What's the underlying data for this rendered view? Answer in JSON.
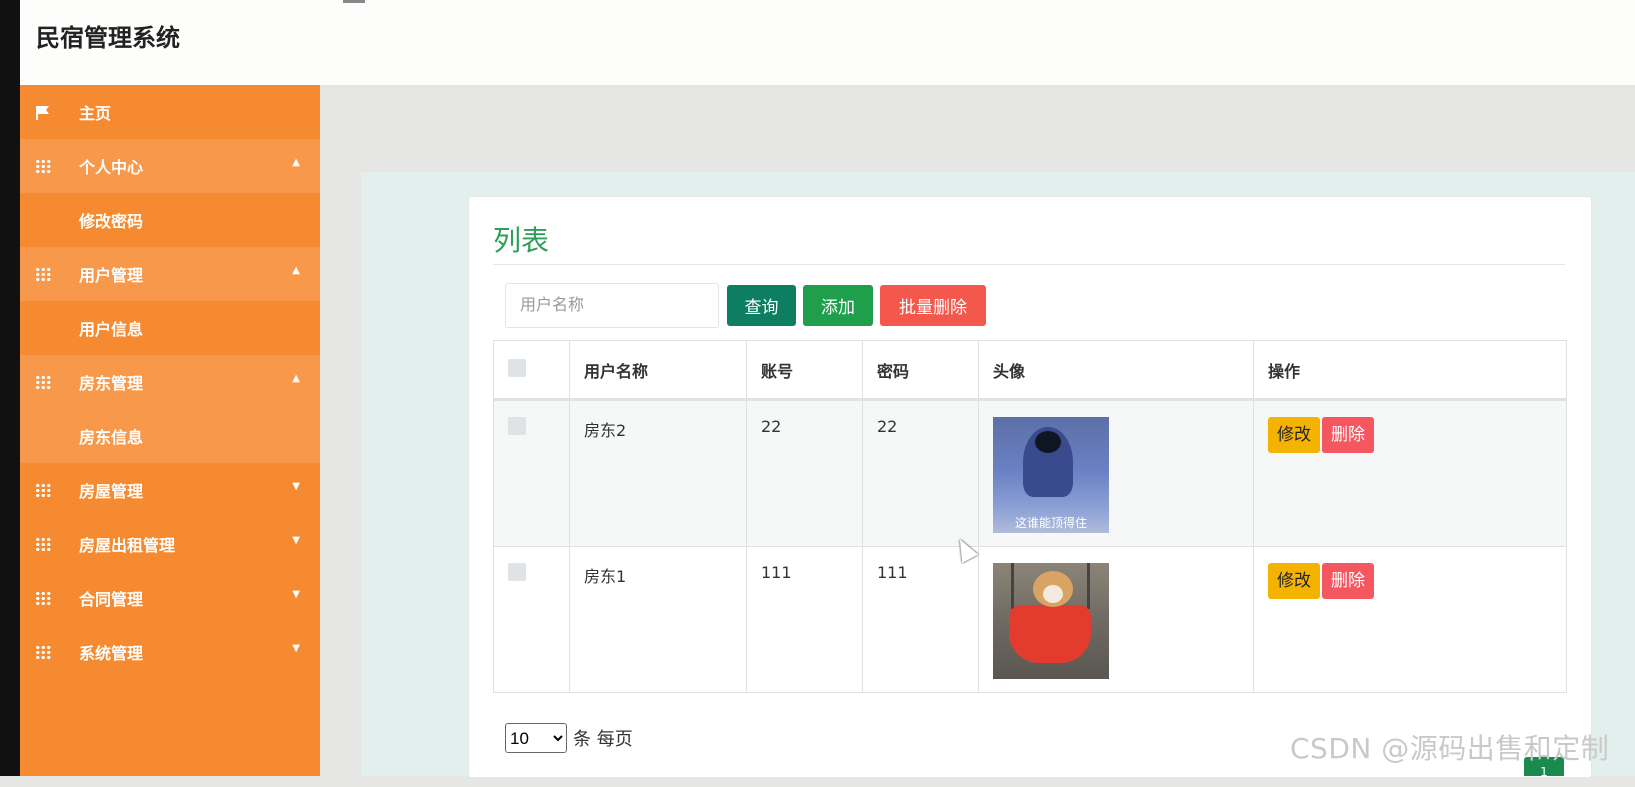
{
  "app": {
    "title": "民宿管理系统"
  },
  "sidebar": {
    "items": [
      {
        "label": "主页",
        "icon": "flag-icon"
      },
      {
        "label": "个人中心",
        "icon": "grid-icon",
        "expanded": true,
        "children": [
          "修改密码"
        ]
      },
      {
        "label": "用户管理",
        "icon": "grid-icon",
        "expanded": true,
        "children": [
          "用户信息"
        ]
      },
      {
        "label": "房东管理",
        "icon": "grid-icon",
        "expanded": true,
        "children": [
          "房东信息"
        ]
      },
      {
        "label": "房屋管理",
        "icon": "grid-icon",
        "expanded": false
      },
      {
        "label": "房屋出租管理",
        "icon": "grid-icon",
        "expanded": false
      },
      {
        "label": "合同管理",
        "icon": "grid-icon",
        "expanded": false
      },
      {
        "label": "系统管理",
        "icon": "grid-icon",
        "expanded": false
      }
    ]
  },
  "main": {
    "title": "列表",
    "search": {
      "placeholder": "用户名称",
      "value": ""
    },
    "buttons": {
      "query": "查询",
      "add": "添加",
      "batch_delete": "批量删除"
    },
    "table": {
      "headers": [
        "用户名称",
        "账号",
        "密码",
        "头像",
        "操作"
      ],
      "rows": [
        {
          "name": "房东2",
          "account": "22",
          "password": "22",
          "avatar_caption": "这谁能顶得住",
          "edit": "修改",
          "delete": "删除"
        },
        {
          "name": "房东1",
          "account": "111",
          "password": "111",
          "avatar_caption": "",
          "edit": "修改",
          "delete": "删除"
        }
      ]
    },
    "pagination": {
      "page_size": "10",
      "page_size_options": [
        "10"
      ],
      "per_page_label": "条 每页",
      "current_page": "1"
    }
  },
  "watermark": "CSDN @源码出售和定制",
  "colors": {
    "sidebar": "#f58a30",
    "accent_green": "#2f9e57",
    "danger": "#f4575f",
    "warning": "#f5b301"
  }
}
